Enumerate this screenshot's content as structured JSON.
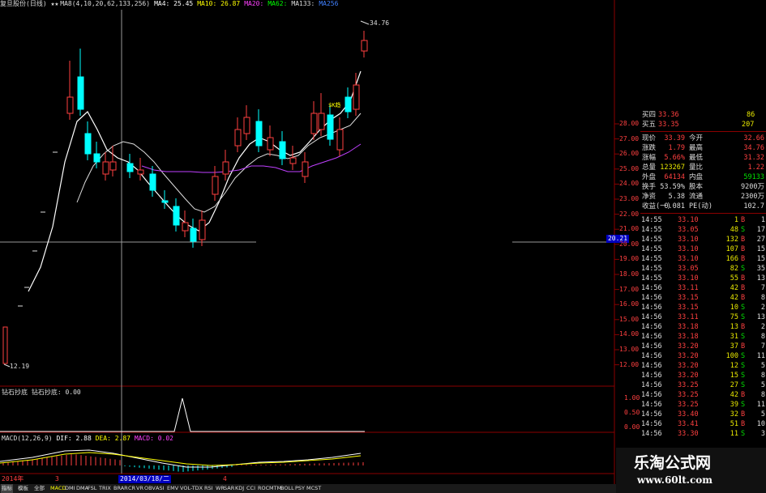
{
  "header": {
    "stock_name": "复旦股份(日线)",
    "stars": "★★",
    "ma_label": "MA8(4,10,20,62,133,256)",
    "ma4": "MA4: 25.45",
    "ma10": "MA10: 26.87",
    "ma20": "MA20:",
    "ma62": "MA62:",
    "ma133": "MA133:",
    "ma256": "MA256"
  },
  "chart_labels": {
    "high_price": "34.76",
    "low_price": "12.19",
    "crosshair_value": "20.21",
    "annotation": "$K趋"
  },
  "right_axis": [
    "28.00",
    "27.00",
    "26.00",
    "25.00",
    "24.00",
    "23.00",
    "22.00",
    "21.00",
    "20.00",
    "19.00",
    "18.00",
    "17.00",
    "16.00",
    "15.00",
    "14.00",
    "13.00",
    "12.00"
  ],
  "indicator1": {
    "title": "钻石抄底",
    "value_label": "钻石抄底: 0.00",
    "axis": [
      "1.00",
      "0.50",
      "0.00"
    ]
  },
  "macd": {
    "title": "MACD(12,26,9)",
    "dif": "DIF: 2.88",
    "dea": "DEA: 2.87",
    "macd": "MACD: 0.02"
  },
  "date_bar": {
    "year": "2014年",
    "month3": "3",
    "month4": "4",
    "cursor_date": "2014/03/18/二"
  },
  "quote": {
    "buy4_label": "买四",
    "buy4_price": "33.36",
    "buy4_vol": "86",
    "buy5_label": "买五",
    "buy5_price": "33.35",
    "buy5_vol": "207",
    "rows": [
      {
        "l1": "现价",
        "v1": "33.39",
        "l2": "今开",
        "v2": "32.66",
        "c1": "#ff4040",
        "c2": "#ff4040"
      },
      {
        "l1": "涨跌",
        "v1": "1.79",
        "l2": "最高",
        "v2": "34.76",
        "c1": "#ff4040",
        "c2": "#ff4040"
      },
      {
        "l1": "涨幅",
        "v1": "5.66%",
        "l2": "最低",
        "v2": "31.32",
        "c1": "#ff4040",
        "c2": "#ff4040"
      },
      {
        "l1": "总量",
        "v1": "123267",
        "l2": "量比",
        "v2": "1.22",
        "c1": "#e8e800",
        "c2": "#ff4040"
      },
      {
        "l1": "外盘",
        "v1": "64134",
        "l2": "内盘",
        "v2": "59133",
        "c1": "#ff4040",
        "c2": "#00e000"
      },
      {
        "l1": "换手",
        "v1": "53.59%",
        "l2": "股本",
        "v2": "9200万",
        "c1": "#dddddd",
        "c2": "#dddddd"
      },
      {
        "l1": "净资",
        "v1": "5.38",
        "l2": "流通",
        "v2": "2300万",
        "c1": "#dddddd",
        "c2": "#dddddd"
      },
      {
        "l1": "收益(一)",
        "v1": "0.081",
        "l2": "PE(动)",
        "v2": "102.7",
        "c1": "#dddddd",
        "c2": "#dddddd"
      }
    ],
    "ticks": [
      {
        "t": "14:55",
        "p": "33.10",
        "v": "1",
        "d": "B",
        "n": "1"
      },
      {
        "t": "14:55",
        "p": "33.05",
        "v": "48",
        "d": "S",
        "n": "17"
      },
      {
        "t": "14:55",
        "p": "33.10",
        "v": "132",
        "d": "B",
        "n": "27"
      },
      {
        "t": "14:55",
        "p": "33.10",
        "v": "107",
        "d": "B",
        "n": "15"
      },
      {
        "t": "14:55",
        "p": "33.10",
        "v": "166",
        "d": "B",
        "n": "15"
      },
      {
        "t": "14:55",
        "p": "33.05",
        "v": "82",
        "d": "S",
        "n": "35"
      },
      {
        "t": "14:55",
        "p": "33.10",
        "v": "55",
        "d": "B",
        "n": "13"
      },
      {
        "t": "14:56",
        "p": "33.11",
        "v": "42",
        "d": "B",
        "n": "7"
      },
      {
        "t": "14:56",
        "p": "33.15",
        "v": "42",
        "d": "B",
        "n": "8"
      },
      {
        "t": "14:56",
        "p": "33.15",
        "v": "10",
        "d": "S",
        "n": "2"
      },
      {
        "t": "14:56",
        "p": "33.11",
        "v": "75",
        "d": "S",
        "n": "13"
      },
      {
        "t": "14:56",
        "p": "33.18",
        "v": "13",
        "d": "B",
        "n": "2"
      },
      {
        "t": "14:56",
        "p": "33.18",
        "v": "31",
        "d": "S",
        "n": "8"
      },
      {
        "t": "14:56",
        "p": "33.20",
        "v": "37",
        "d": "B",
        "n": "7"
      },
      {
        "t": "14:56",
        "p": "33.20",
        "v": "100",
        "d": "S",
        "n": "11"
      },
      {
        "t": "14:56",
        "p": "33.20",
        "v": "12",
        "d": "S",
        "n": "5"
      },
      {
        "t": "14:56",
        "p": "33.20",
        "v": "15",
        "d": "S",
        "n": "8"
      },
      {
        "t": "14:56",
        "p": "33.25",
        "v": "27",
        "d": "S",
        "n": "5"
      },
      {
        "t": "14:56",
        "p": "33.25",
        "v": "42",
        "d": "B",
        "n": "8"
      },
      {
        "t": "14:56",
        "p": "33.25",
        "v": "39",
        "d": "S",
        "n": "11"
      },
      {
        "t": "14:56",
        "p": "33.40",
        "v": "32",
        "d": "B",
        "n": "5"
      },
      {
        "t": "14:56",
        "p": "33.41",
        "v": "51",
        "d": "B",
        "n": "10"
      },
      {
        "t": "14:56",
        "p": "33.30",
        "v": "11",
        "d": "S",
        "n": "3"
      }
    ]
  },
  "tabs": [
    "指标",
    "模板",
    "全部",
    "MACD",
    "DMI",
    "DMA",
    "FSL",
    "TRIX",
    "BRAR",
    "CR",
    "VR",
    "OBV",
    "ASI",
    "EMV",
    "VOL-TDX",
    "RSI",
    "WR",
    "SAR",
    "KDJ",
    "CCI",
    "ROC",
    "MTM",
    "BOLL",
    "PSY",
    "MCST"
  ],
  "watermark": {
    "title": "乐淘公式网",
    "url": "www.60lt.com"
  },
  "colors": {
    "up": "#ff4040",
    "down": "#00ffff",
    "grid": "#8b0000",
    "ma_white": "#ffffff",
    "ma_yellow": "#ffff00",
    "ma_purple": "#c040ff"
  }
}
